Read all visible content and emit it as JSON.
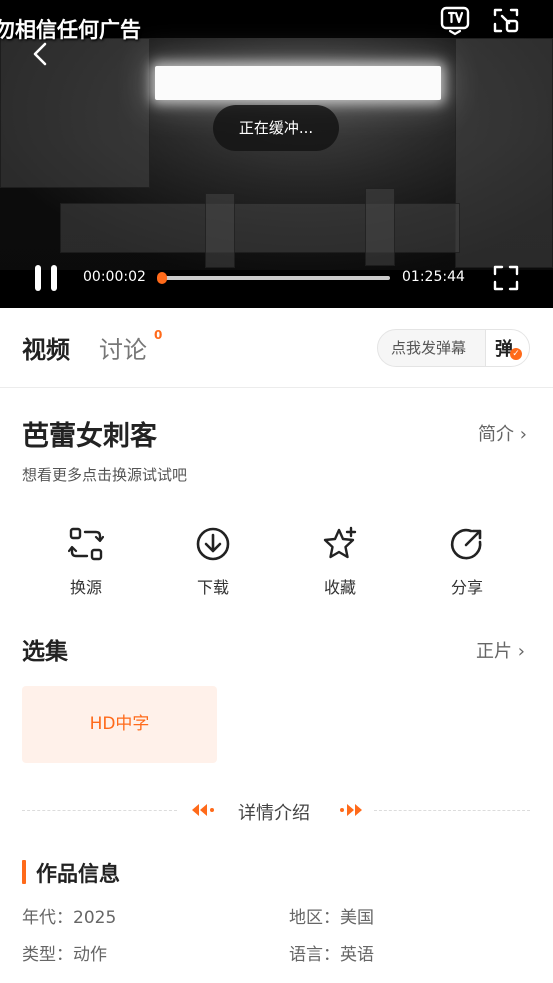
{
  "player": {
    "ad_warning": "勿相信任何广告",
    "buffering_text": "正在缓冲...",
    "current_time": "00:00:02",
    "total_time": "01:25:44",
    "progress_fraction": 0.0004
  },
  "tabs": {
    "video": "视频",
    "discuss": "讨论",
    "discuss_count": "0"
  },
  "danmaku": {
    "placeholder": "点我发弹幕",
    "toggle_char": "弹",
    "toggle_check": "✓"
  },
  "show": {
    "title": "芭蕾女刺客",
    "intro_link": "简介 ›",
    "subtitle": "想看更多点击换源试试吧"
  },
  "actions": [
    {
      "label": "换源",
      "icon": "switch-source-icon"
    },
    {
      "label": "下载",
      "icon": "download-icon"
    },
    {
      "label": "收藏",
      "icon": "favorite-star-icon"
    },
    {
      "label": "分享",
      "icon": "share-icon"
    }
  ],
  "episodes": {
    "title": "选集",
    "link": "正片 ›",
    "items": [
      {
        "label": "HD中字"
      }
    ]
  },
  "details": {
    "heading": "详情介绍"
  },
  "works_info": {
    "title": "作品信息",
    "year": "年代：2025",
    "region": "地区：美国",
    "genre": "类型：动作",
    "language": "语言：英语"
  },
  "colors": {
    "accent": "#ff6a1a",
    "episode_bg": "#fff1ea"
  }
}
